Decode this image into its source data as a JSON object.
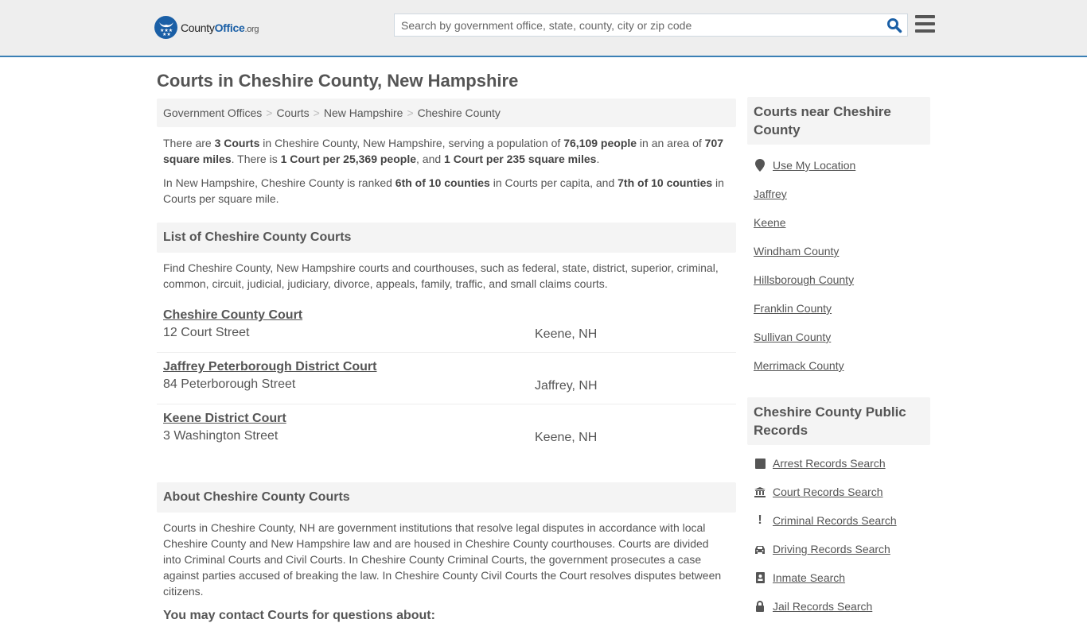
{
  "header": {
    "logo": {
      "name": "County",
      "name_accent": "Office",
      "tld": ".org"
    },
    "search": {
      "placeholder": "Search by government office, state, county, city or zip code",
      "value": ""
    },
    "colors": {
      "brand": "#1a5fa6",
      "accent_border": "#3a7fb5",
      "header_bg": "#eeeeee"
    }
  },
  "page": {
    "title": "Courts in Cheshire County, New Hampshire",
    "breadcrumb": [
      "Government Offices",
      "Courts",
      "New Hampshire",
      "Cheshire County"
    ],
    "summary": {
      "p1": {
        "t1": "There are ",
        "b1": "3 Courts",
        "t2": " in Cheshire County, New Hampshire, serving a population of ",
        "b2": "76,109 people",
        "t3": " in an area of ",
        "b3": "707 square miles",
        "t4": ". There is ",
        "b4": "1 Court per 25,369 people",
        "t5": ", and ",
        "b5": "1 Court per 235 square miles",
        "t6": "."
      },
      "p2": {
        "t1": "In New Hampshire, Cheshire County is ranked ",
        "b1": "6th of 10 counties",
        "t2": " in Courts per capita, and ",
        "b2": "7th of 10 counties",
        "t3": " in Courts per square mile."
      }
    },
    "list_section": {
      "heading": "List of Cheshire County Courts",
      "intro": "Find Cheshire County, New Hampshire courts and courthouses, such as federal, state, district, superior, criminal, common, circuit, judicial, judiciary, divorce, appeals, family, traffic, and small claims courts.",
      "courts": [
        {
          "name": "Cheshire County Court",
          "address": "12 Court Street",
          "city": "Keene, NH"
        },
        {
          "name": "Jaffrey Peterborough District Court",
          "address": "84 Peterborough Street",
          "city": "Jaffrey, NH"
        },
        {
          "name": "Keene District Court",
          "address": "3 Washington Street",
          "city": "Keene, NH"
        }
      ]
    },
    "about_section": {
      "heading": "About Cheshire County Courts",
      "body": "Courts in Cheshire County, NH are government institutions that resolve legal disputes in accordance with local Cheshire County and New Hampshire law and are housed in Cheshire County courthouses. Courts are divided into Criminal Courts and Civil Courts. In Cheshire County Criminal Courts, the government prosecutes a case against parties accused of breaking the law. In Cheshire County Civil Courts the Court resolves disputes between citizens.",
      "next_heading": "You may contact Courts for questions about:"
    }
  },
  "sidebar": {
    "nearby": {
      "heading": "Courts near Cheshire County",
      "use_location": "Use My Location",
      "items": [
        "Jaffrey",
        "Keene",
        "Windham County",
        "Hillsborough County",
        "Franklin County",
        "Sullivan County",
        "Merrimack County"
      ]
    },
    "records": {
      "heading": "Cheshire County Public Records",
      "items": [
        {
          "label": "Arrest Records Search",
          "icon": "square-icon"
        },
        {
          "label": "Court Records Search",
          "icon": "courthouse-icon"
        },
        {
          "label": "Criminal Records Search",
          "icon": "exclamation-icon"
        },
        {
          "label": "Driving Records Search",
          "icon": "car-icon"
        },
        {
          "label": "Inmate Search",
          "icon": "id-badge-icon"
        },
        {
          "label": "Jail Records Search",
          "icon": "lock-icon"
        }
      ]
    }
  }
}
